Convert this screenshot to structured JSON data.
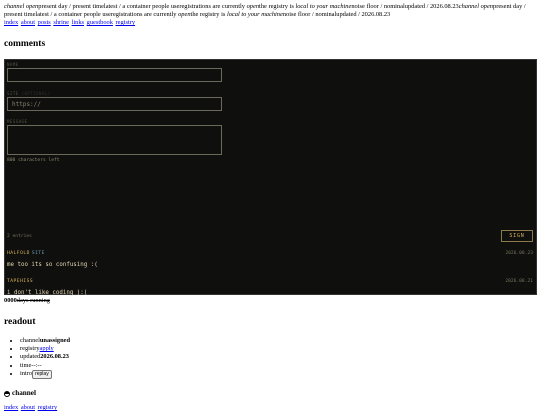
{
  "ticker": {
    "segments": [
      {
        "t": "channel open",
        "i": true
      },
      {
        "t": "present day / present time",
        "i": false
      },
      {
        "t": "latest / a container people use",
        "i": false
      },
      {
        "t": "registrations are currently ",
        "i": false
      },
      {
        "t": "open",
        "i": true
      },
      {
        "t": "the registry is ",
        "i": false
      },
      {
        "t": "local to your machine",
        "i": true
      },
      {
        "t": "noise floor / nominal",
        "i": false
      },
      {
        "t": "updated / 2026.08.23",
        "i": false
      },
      {
        "t": "channel open",
        "i": true
      },
      {
        "t": "present day / present time",
        "i": false
      },
      {
        "t": "latest / a container people use",
        "i": false
      },
      {
        "t": "registrations are currently ",
        "i": false
      },
      {
        "t": "open",
        "i": true
      },
      {
        "t": "the registry is ",
        "i": false
      },
      {
        "t": "local to your machine",
        "i": true
      },
      {
        "t": "noise floor / nominal",
        "i": false
      },
      {
        "t": "updated / 2026.08.23",
        "i": false
      }
    ]
  },
  "nav": [
    "index",
    "about",
    "posts",
    "shrine",
    "links",
    "guestbook",
    "registry"
  ],
  "comments_heading": "comments",
  "form": {
    "name_label": "NAME",
    "site_label": "SITE",
    "site_optional": "(OPTIONAL)",
    "site_placeholder": "https://",
    "message_label": "MESSAGE",
    "chars_left": "800 characters left",
    "entries_count": "2 entries",
    "sign_label": "SIGN"
  },
  "entries": [
    {
      "name": "HALFOLD",
      "site": "SITE",
      "date": "2026.08.23",
      "text": "me too its so confusing :("
    },
    {
      "name": "TAPEHISS",
      "site": "",
      "date": "2026.08.21",
      "text": "i don't like coding ):("
    }
  ],
  "running": {
    "count": "0000",
    "label": "days running"
  },
  "readout": {
    "heading": "readout",
    "items": [
      {
        "key": "channel",
        "val": "unassigned"
      },
      {
        "key": "registry",
        "link": "apply"
      },
      {
        "key": "updated",
        "val": "2026.08.23"
      },
      {
        "key": "time",
        "plain": "--:--"
      },
      {
        "key": "intro",
        "button": "replay"
      }
    ]
  },
  "channel": {
    "heading": "channel",
    "links": [
      "index",
      "about",
      "registry"
    ]
  }
}
